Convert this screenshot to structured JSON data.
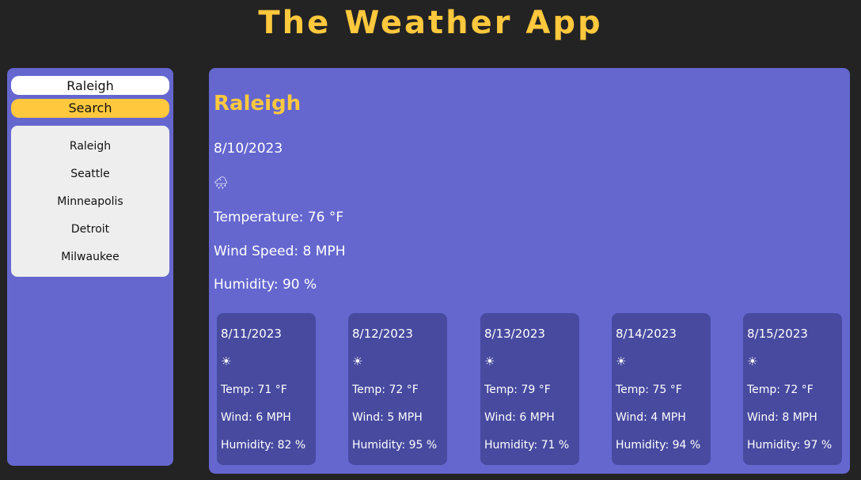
{
  "app": {
    "title": "The Weather App"
  },
  "sidebar": {
    "search_value": "Raleigh",
    "search_button": "Search",
    "history": [
      "Raleigh",
      "Seattle",
      "Minneapolis",
      "Detroit",
      "Milwaukee"
    ]
  },
  "current": {
    "city": "Raleigh",
    "date": "8/10/2023",
    "icon": "rain-cloud-icon",
    "icon_glyph": "🌧",
    "temperature": "Temperature: 76 °F",
    "wind": "Wind Speed: 8 MPH",
    "humidity": "Humidity: 90 %"
  },
  "forecast": [
    {
      "date": "8/11/2023",
      "icon": "sun-icon",
      "icon_glyph": "☀",
      "temp": "Temp: 71 °F",
      "wind": "Wind: 6 MPH",
      "humidity": "Humidity: 82 %"
    },
    {
      "date": "8/12/2023",
      "icon": "sun-icon",
      "icon_glyph": "☀",
      "temp": "Temp: 72 °F",
      "wind": "Wind: 5 MPH",
      "humidity": "Humidity: 95 %"
    },
    {
      "date": "8/13/2023",
      "icon": "sun-icon",
      "icon_glyph": "☀",
      "temp": "Temp: 79 °F",
      "wind": "Wind: 6 MPH",
      "humidity": "Humidity: 71 %"
    },
    {
      "date": "8/14/2023",
      "icon": "sun-icon",
      "icon_glyph": "☀",
      "temp": "Temp: 75 °F",
      "wind": "Wind: 4 MPH",
      "humidity": "Humidity: 94 %"
    },
    {
      "date": "8/15/2023",
      "icon": "sun-icon",
      "icon_glyph": "☀",
      "temp": "Temp: 72 °F",
      "wind": "Wind: 8 MPH",
      "humidity": "Humidity: 97 %"
    }
  ],
  "colors": {
    "background": "#232323",
    "panel": "#6567cf",
    "card": "#474a9f",
    "accent": "#ffc83d",
    "history_bg": "#eeeeee"
  }
}
